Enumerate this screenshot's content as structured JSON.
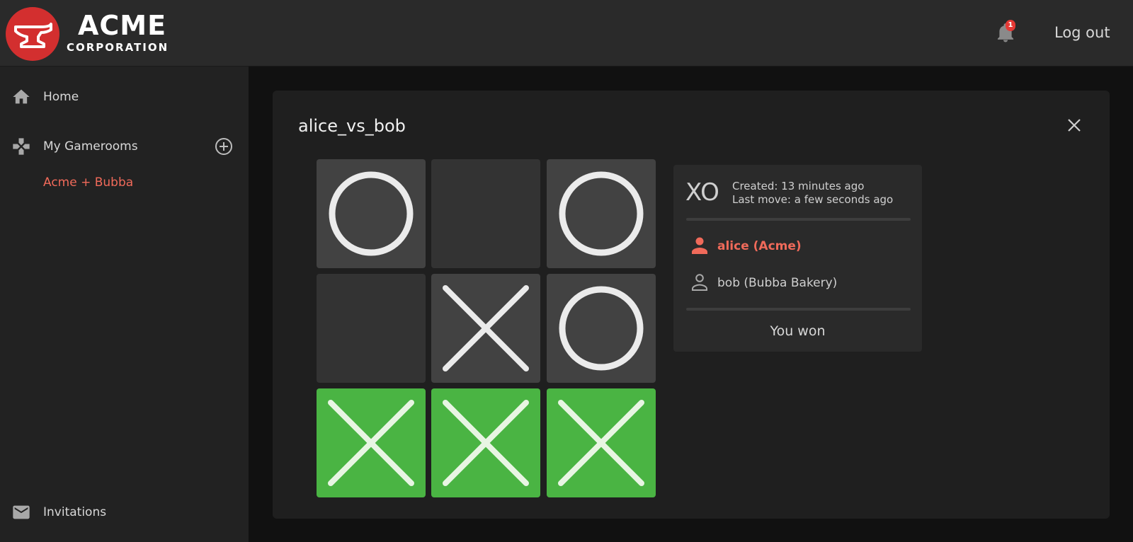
{
  "header": {
    "logo_line1": "ACME",
    "logo_line2": "CORPORATION",
    "notification_count": "1",
    "logout_label": "Log out"
  },
  "sidebar": {
    "home_label": "Home",
    "gamerooms_label": "My Gamerooms",
    "gameroom_item": "Acme + Bubba",
    "invitations_label": "Invitations"
  },
  "game": {
    "title": "alice_vs_bob",
    "board": [
      "O",
      "",
      "O",
      "",
      "X",
      "O",
      "X",
      "X",
      "X"
    ],
    "winning_cells": [
      6,
      7,
      8
    ]
  },
  "info": {
    "game_type": "XO",
    "created": "Created: 13 minutes ago",
    "last_move": "Last move: a few seconds ago",
    "player1": "alice (Acme)",
    "player2": "bob (Bubba Bakery)",
    "result": "You won"
  },
  "colors": {
    "accent": "#f06a5a",
    "logo_red": "#d32f2f",
    "win_green": "#4ab443"
  }
}
